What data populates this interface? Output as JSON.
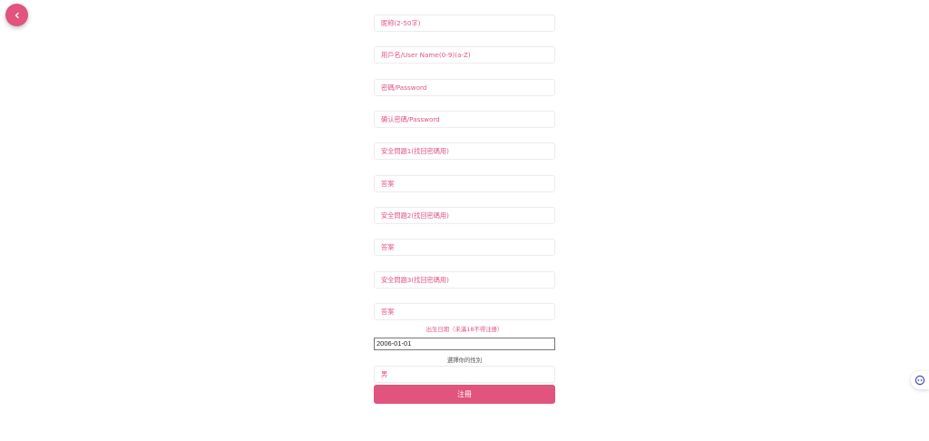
{
  "form": {
    "nickname_placeholder": "昵称(2-50字)",
    "username_placeholder": "用戶名/User Name(0-9)(a-Z)",
    "password_placeholder": "密碼/Password",
    "confirm_password_placeholder": "确认密碼/Password",
    "question1_placeholder": "安全問題1(找回密碼用)",
    "answer1_placeholder": "答案",
    "question2_placeholder": "安全問題2(找回密碼用)",
    "answer2_placeholder": "答案",
    "question3_placeholder": "安全問題3(找回密碼用)",
    "answer3_placeholder": "答案",
    "birth_date_label": "出生日期（未滿18不得注册）",
    "birth_date_value": "2006-01-01",
    "gender_label": "選擇你的性別",
    "gender_value": "男",
    "submit_label": "注冊"
  },
  "icons": {
    "back": "chevron-left-icon",
    "assistant": "robot-face-icon"
  },
  "colors": {
    "accent": "#e0547e",
    "background": "#ffffff",
    "field_border": "#ececec"
  }
}
